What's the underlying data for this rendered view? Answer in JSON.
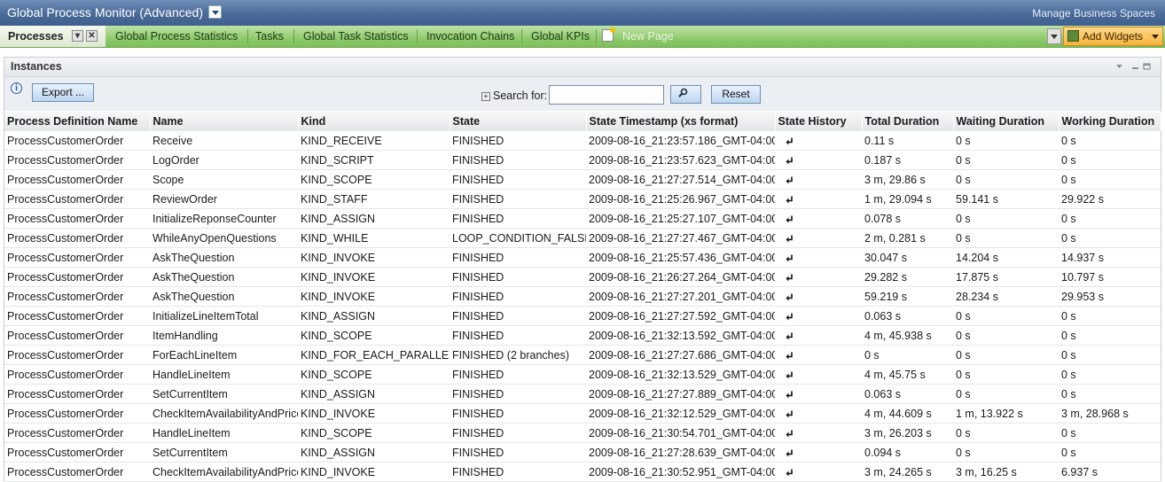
{
  "app": {
    "title": "Global Process Monitor (Advanced)",
    "manage_link": "Manage Business Spaces"
  },
  "tabs": [
    {
      "label": "Processes",
      "active": true
    },
    {
      "label": "Global Process Statistics"
    },
    {
      "label": "Tasks"
    },
    {
      "label": "Global Task Statistics"
    },
    {
      "label": "Invocation Chains"
    },
    {
      "label": "Global KPIs"
    },
    {
      "label": "New Page"
    }
  ],
  "add_widgets_label": "Add Widgets",
  "panel": {
    "title": "Instances",
    "export_label": "Export ...",
    "search_label": "Search for:",
    "search_value": "",
    "reset_label": "Reset"
  },
  "table": {
    "columns": [
      "Process Definition Name",
      "Name",
      "Kind",
      "State",
      "State Timestamp (xs format)",
      "State History",
      "Total Duration",
      "Waiting Duration",
      "Working Duration"
    ],
    "rows": [
      [
        "ProcessCustomerOrder",
        "Receive",
        "KIND_RECEIVE",
        "FINISHED",
        "2009-08-16_21:23:57.186_GMT-04:00",
        "0.11 s",
        "0 s",
        "0 s"
      ],
      [
        "ProcessCustomerOrder",
        "LogOrder",
        "KIND_SCRIPT",
        "FINISHED",
        "2009-08-16_21:23:57.623_GMT-04:00",
        "0.187 s",
        "0 s",
        "0 s"
      ],
      [
        "ProcessCustomerOrder",
        "Scope",
        "KIND_SCOPE",
        "FINISHED",
        "2009-08-16_21:27:27.514_GMT-04:00",
        "3 m, 29.86 s",
        "0 s",
        "0 s"
      ],
      [
        "ProcessCustomerOrder",
        "ReviewOrder",
        "KIND_STAFF",
        "FINISHED",
        "2009-08-16_21:25:26.967_GMT-04:00",
        "1 m, 29.094 s",
        "59.141 s",
        "29.922 s"
      ],
      [
        "ProcessCustomerOrder",
        "InitializeReponseCounter",
        "KIND_ASSIGN",
        "FINISHED",
        "2009-08-16_21:25:27.107_GMT-04:00",
        "0.078 s",
        "0 s",
        "0 s"
      ],
      [
        "ProcessCustomerOrder",
        "WhileAnyOpenQuestions",
        "KIND_WHILE",
        "LOOP_CONDITION_FALSE",
        "2009-08-16_21:27:27.467_GMT-04:00",
        "2 m, 0.281 s",
        "0 s",
        "0 s"
      ],
      [
        "ProcessCustomerOrder",
        "AskTheQuestion",
        "KIND_INVOKE",
        "FINISHED",
        "2009-08-16_21:25:57.436_GMT-04:00",
        "30.047 s",
        "14.204 s",
        "14.937 s"
      ],
      [
        "ProcessCustomerOrder",
        "AskTheQuestion",
        "KIND_INVOKE",
        "FINISHED",
        "2009-08-16_21:26:27.264_GMT-04:00",
        "29.282 s",
        "17.875 s",
        "10.797 s"
      ],
      [
        "ProcessCustomerOrder",
        "AskTheQuestion",
        "KIND_INVOKE",
        "FINISHED",
        "2009-08-16_21:27:27.201_GMT-04:00",
        "59.219 s",
        "28.234 s",
        "29.953 s"
      ],
      [
        "ProcessCustomerOrder",
        "InitializeLineItemTotal",
        "KIND_ASSIGN",
        "FINISHED",
        "2009-08-16_21:27:27.592_GMT-04:00",
        "0.063 s",
        "0 s",
        "0 s"
      ],
      [
        "ProcessCustomerOrder",
        "ItemHandling",
        "KIND_SCOPE",
        "FINISHED",
        "2009-08-16_21:32:13.592_GMT-04:00",
        "4 m, 45.938 s",
        "0 s",
        "0 s"
      ],
      [
        "ProcessCustomerOrder",
        "ForEachLineItem",
        "KIND_FOR_EACH_PARALLEL",
        "FINISHED (2 branches)",
        "2009-08-16_21:27:27.686_GMT-04:00",
        "0 s",
        "0 s",
        "0 s"
      ],
      [
        "ProcessCustomerOrder",
        "HandleLineItem",
        "KIND_SCOPE",
        "FINISHED",
        "2009-08-16_21:32:13.529_GMT-04:00",
        "4 m, 45.75 s",
        "0 s",
        "0 s"
      ],
      [
        "ProcessCustomerOrder",
        "SetCurrentItem",
        "KIND_ASSIGN",
        "FINISHED",
        "2009-08-16_21:27:27.889_GMT-04:00",
        "0.063 s",
        "0 s",
        "0 s"
      ],
      [
        "ProcessCustomerOrder",
        "CheckItemAvailabilityAndPrice",
        "KIND_INVOKE",
        "FINISHED",
        "2009-08-16_21:32:12.529_GMT-04:00",
        "4 m, 44.609 s",
        "1 m, 13.922 s",
        "3 m, 28.968 s"
      ],
      [
        "ProcessCustomerOrder",
        "HandleLineItem",
        "KIND_SCOPE",
        "FINISHED",
        "2009-08-16_21:30:54.701_GMT-04:00",
        "3 m, 26.203 s",
        "0 s",
        "0 s"
      ],
      [
        "ProcessCustomerOrder",
        "SetCurrentItem",
        "KIND_ASSIGN",
        "FINISHED",
        "2009-08-16_21:27:28.639_GMT-04:00",
        "0.094 s",
        "0 s",
        "0 s"
      ],
      [
        "ProcessCustomerOrder",
        "CheckItemAvailabilityAndPrice",
        "KIND_INVOKE",
        "FINISHED",
        "2009-08-16_21:30:52.951_GMT-04:00",
        "3 m, 24.265 s",
        "3 m, 16.25 s",
        "6.937 s"
      ]
    ]
  },
  "icons": {
    "state_history": "history-arrow-icon",
    "search": "search-icon",
    "info": "info-icon"
  },
  "colors": {
    "title_bar": "#4a6a98",
    "tab_bar": "#8fca6d",
    "add_widgets": "#f6b43a",
    "button": "#bcd6f0"
  }
}
